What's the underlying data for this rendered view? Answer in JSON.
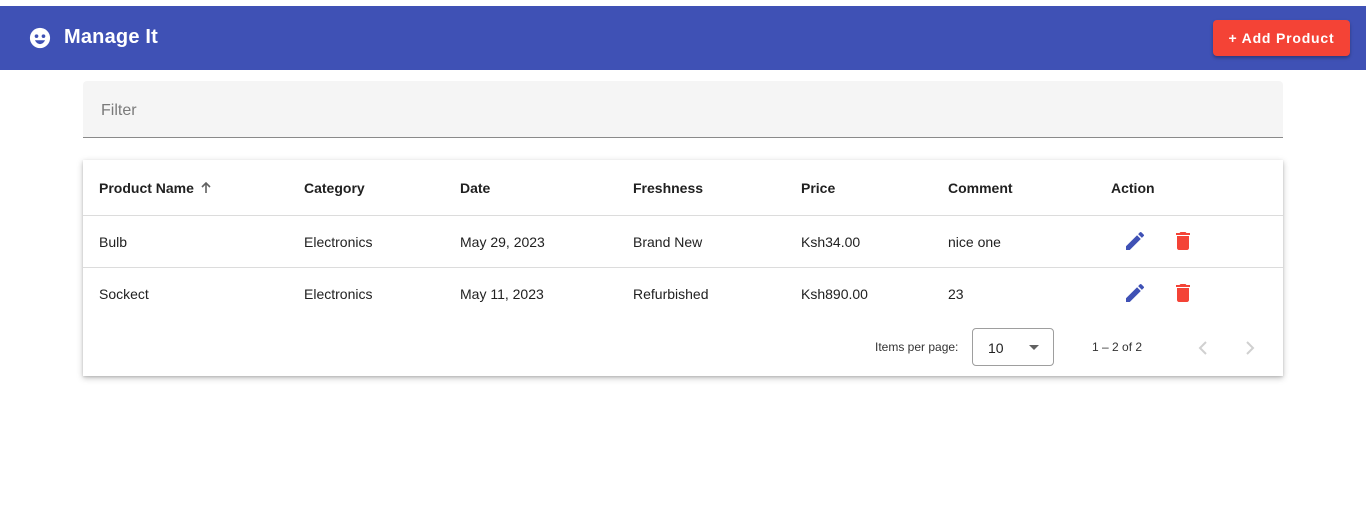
{
  "app": {
    "title": "Manage It",
    "add_button_label": "+ Add Product"
  },
  "filter": {
    "placeholder": "Filter",
    "value": ""
  },
  "table": {
    "columns": [
      "Product Name",
      "Category",
      "Date",
      "Freshness",
      "Price",
      "Comment",
      "Action"
    ],
    "sort": {
      "column": "Product Name",
      "direction": "ascending"
    },
    "rows": [
      {
        "name": "Bulb",
        "category": "Electronics",
        "date": "May 29, 2023",
        "freshness": "Brand New",
        "price": "Ksh34.00",
        "comment": "nice one"
      },
      {
        "name": "Sockect",
        "category": "Electronics",
        "date": "May 11, 2023",
        "freshness": "Refurbished",
        "price": "Ksh890.00",
        "comment": "23"
      }
    ]
  },
  "paginator": {
    "items_per_page_label": "Items per page:",
    "items_per_page_value": "10",
    "range_label": "1 – 2 of 2"
  },
  "icons": {
    "app": "face-icon",
    "sort": "arrow-up-icon",
    "edit": "pencil-icon",
    "delete": "trash-icon",
    "dropdown": "caret-down-icon",
    "prev": "chevron-left-icon",
    "next": "chevron-right-icon"
  },
  "colors": {
    "primary": "#3f51b5",
    "accent": "#f44336"
  }
}
